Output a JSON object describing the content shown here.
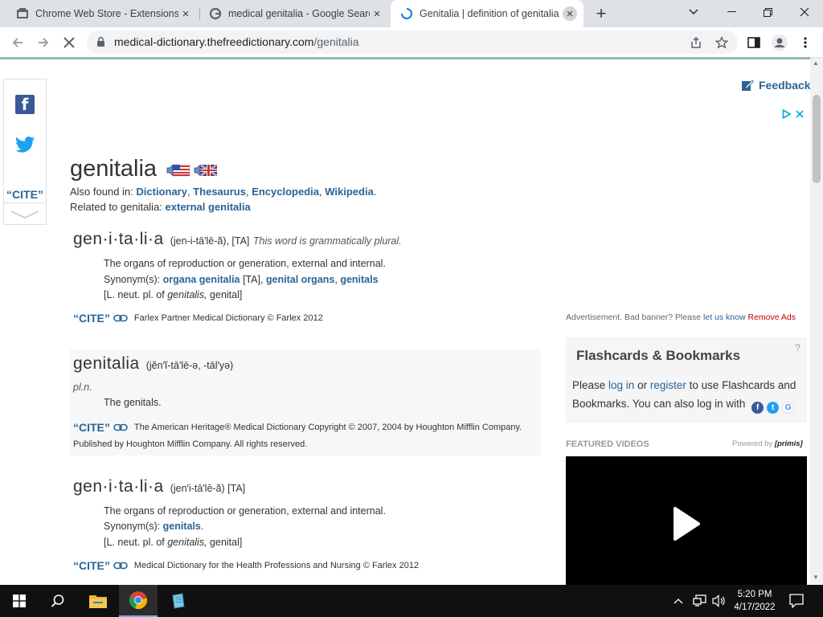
{
  "browser": {
    "tabs": [
      {
        "title": "Chrome Web Store - Extensions",
        "icon": "chrome-web-store-icon"
      },
      {
        "title": "medical genitalia - Google Search",
        "icon": "google-icon"
      },
      {
        "title": "Genitalia | definition of genitalia",
        "icon": "loading-spinner-icon",
        "active": true
      }
    ],
    "url_host": "medical-dictionary.thefreedictionary.com",
    "url_path": "/genitalia"
  },
  "share": {
    "cite_label": "“CITE”"
  },
  "feedback_label": "Feedback",
  "word": {
    "headword": "genitalia",
    "also_found_prefix": "Also found in: ",
    "also_found": [
      "Dictionary",
      "Thesaurus",
      "Encyclopedia",
      "Wikipedia"
    ],
    "related_prefix": "Related to genitalia: ",
    "related": "external genitalia"
  },
  "entries": {
    "e1": {
      "headword": "gen·i·ta·li·a",
      "pron": "(jen-i-tā'lē-ă), [TA]",
      "gram": "This word is grammatically plural.",
      "def": "The organs of reproduction or generation, external and internal.",
      "syn_prefix": "Synonym(s): ",
      "syn1": "organa genitalia",
      "syn_ta": " [TA], ",
      "syn2": "genital organs",
      "syn_comma": ", ",
      "syn3": "genitals",
      "etym_prefix": "[L. neut. pl. of ",
      "etym_word": "genitalis,",
      "etym_suffix": " genital]",
      "cite": "“CITE”",
      "source": "Farlex Partner Medical Dictionary © Farlex 2012"
    },
    "e2": {
      "headword": "genitalia",
      "pron": "(jĕn′ĭ-tā′lē-ə, -tāl′yə)",
      "pos": "pl.n.",
      "def": "The genitals.",
      "cite": "“CITE”",
      "source1": "The American Heritage® Medical Dictionary Copyright © 2007, 2004 by Houghton Mifflin Company.",
      "source2": "Published by Houghton Mifflin Company. All rights reserved."
    },
    "e3": {
      "headword": "gen·i·ta·li·a",
      "pron": "(jen'i-tā'lē-ă) [TA]",
      "def": "The organs of reproduction or generation, external and internal.",
      "syn_prefix": "Synonym(s): ",
      "syn1": "genitals",
      "syn_period": ".",
      "etym_prefix": "[L. neut. pl. of ",
      "etym_word": "genitalis,",
      "etym_suffix": " genital]",
      "cite": "“CITE”",
      "source": "Medical Dictionary for the Health Professions and Nursing © Farlex 2012"
    }
  },
  "ads": {
    "note_prefix": "Advertisement. Bad banner? Please ",
    "let_us_know": "let us know",
    "remove_ads": "Remove Ads"
  },
  "flashcards": {
    "title": "Flashcards & Bookmarks",
    "help": "?",
    "t1": "Please ",
    "login": "log in",
    "t2": " or ",
    "register": "register",
    "t3": " to use Flashcards and Bookmarks. You can also log in with"
  },
  "videos": {
    "label": "FEATURED VIDEOS",
    "powered_prefix": "Powered by ",
    "powered_brand": "[primis]"
  },
  "taskbar": {
    "time": "5:20 PM",
    "date": "4/17/2022"
  },
  "colors": {
    "link": "#2a6496",
    "accent": "#00aecd",
    "remove_ads": "#cc0000"
  }
}
